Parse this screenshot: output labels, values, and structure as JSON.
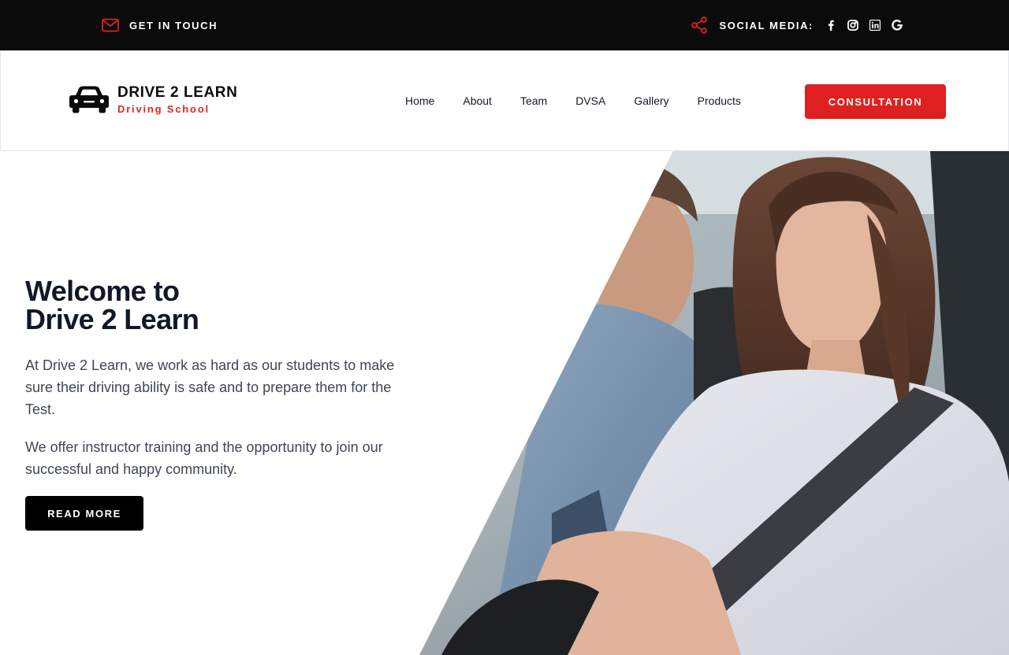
{
  "topbar": {
    "contact_label": "GET IN TOUCH",
    "contact_icon": "mail-icon",
    "social_label": "SOCIAL MEDIA:",
    "social_icon": "share-icon",
    "social_links": [
      "facebook-icon",
      "instagram-icon",
      "linkedin-icon",
      "google-icon"
    ]
  },
  "header": {
    "logo_name": "DRIVE 2 LEARN",
    "logo_sub": "Driving School",
    "nav": [
      "Home",
      "About",
      "Team",
      "DVSA",
      "Gallery",
      "Products"
    ],
    "cta_label": "CONSULTATION"
  },
  "hero": {
    "title_line1": "Welcome to",
    "title_line2": "Drive 2 Learn",
    "paragraph1": "At Drive 2 Learn, we work as hard as our students to make sure their driving ability is safe and to prepare them for the Test.",
    "paragraph2": "We offer instructor training and the opportunity to join our successful and happy community.",
    "button_label": "READ MORE"
  },
  "colors": {
    "accent": "#df2020",
    "topbar_bg": "#0b0b0b",
    "heading": "#111827",
    "body_text": "#3f4654"
  }
}
